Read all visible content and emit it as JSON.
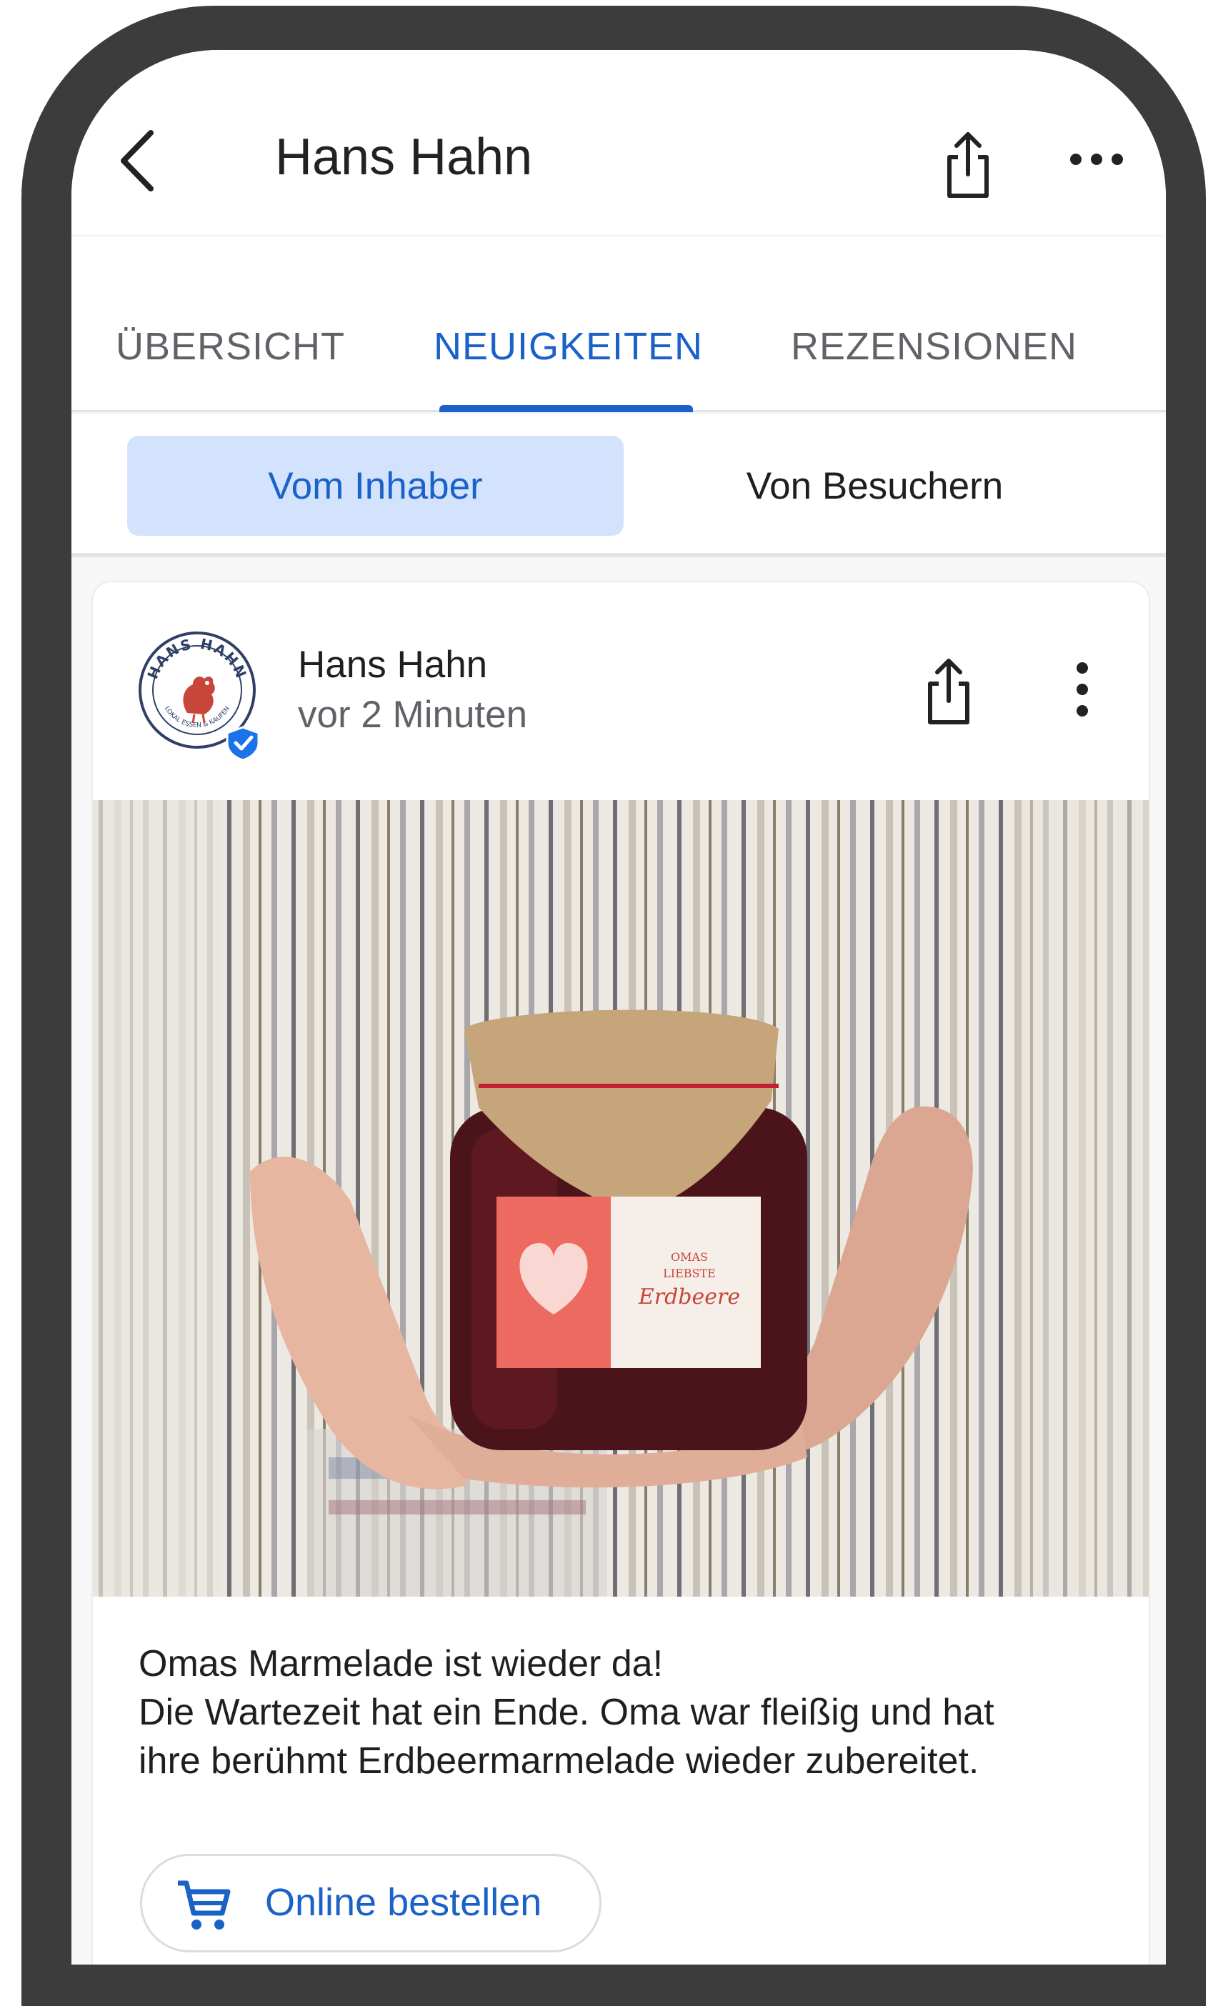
{
  "header": {
    "title": "Hans Hahn",
    "back_icon": "chevron-left-icon",
    "share_icon": "share-icon",
    "more_icon": "more-horizontal-icon"
  },
  "tabs": [
    {
      "label": "ÜBERSICHT",
      "active": false
    },
    {
      "label": "NEUIGKEITEN",
      "active": true
    },
    {
      "label": "REZENSIONEN",
      "active": false
    }
  ],
  "segments": [
    {
      "label": "Vom Inhaber",
      "selected": true
    },
    {
      "label": "Von Besuchern",
      "selected": false
    }
  ],
  "post": {
    "author": "Hans Hahn",
    "time": "vor 2 Minuten",
    "verified": true,
    "logo_text": "HANS HAHN",
    "logo_subtext": "LOKAL ESSEN & KAUFEN",
    "image_label": {
      "line1": "OMAS",
      "line2": "LIEBSTE",
      "line3": "Erdbeere"
    },
    "text_lines": [
      "Omas Marmelade ist wieder da!",
      "Die Wartezeit hat ein Ende. Oma war fleißig und hat",
      "ihre berühmt Erdbeermarmelade wieder zubereitet."
    ],
    "cta_label": "Online bestellen",
    "cta_icon": "shopping-cart-icon"
  },
  "colors": {
    "accent": "#1a62c8",
    "segment_selected_bg": "#d3e3fd",
    "frame": "#3c3c3c"
  }
}
